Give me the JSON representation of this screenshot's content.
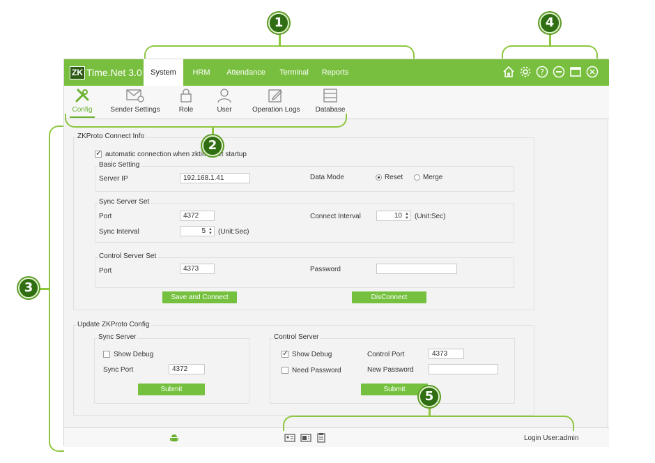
{
  "callouts": [
    "1",
    "2",
    "3",
    "4",
    "5"
  ],
  "app": {
    "logo_mark": "ZK",
    "logo_text": "Time.Net",
    "version": "3.0",
    "brand_color": "#79bf3f",
    "accent_color": "#6ab12f"
  },
  "nav": [
    {
      "label": "System",
      "active": true
    },
    {
      "label": "HRM",
      "active": false
    },
    {
      "label": "Attendance",
      "active": false
    },
    {
      "label": "Terminal",
      "active": false
    },
    {
      "label": "Reports",
      "active": false
    }
  ],
  "window_icons": [
    "home-icon",
    "gear-icon",
    "help-icon",
    "minimize-icon",
    "maximize-icon",
    "close-icon"
  ],
  "toolbar": [
    {
      "label": "Config",
      "icon": "tools-icon",
      "active": true
    },
    {
      "label": "Sender Settings",
      "icon": "mail-settings-icon",
      "active": false
    },
    {
      "label": "Role",
      "icon": "lock-icon",
      "active": false
    },
    {
      "label": "User",
      "icon": "user-icon",
      "active": false
    },
    {
      "label": "Operation Logs",
      "icon": "edit-log-icon",
      "active": false
    },
    {
      "label": "Database",
      "icon": "database-icon",
      "active": false
    }
  ],
  "connect": {
    "title": "ZKProto Connect Info",
    "auto_label": "automatic connection when zktime net startup",
    "auto_checked": true,
    "basic": {
      "title": "Basic Setting",
      "server_ip_label": "Server IP",
      "server_ip": "192.168.1.41",
      "data_mode_label": "Data Mode",
      "mode_reset": "Reset",
      "mode_merge": "Merge",
      "selected_mode": "Reset"
    },
    "sync": {
      "title": "Sync Server Set",
      "port_label": "Port",
      "port": "4372",
      "connect_interval_label": "Connect Interval",
      "connect_interval": "10",
      "connect_unit": "(Unit:Sec)",
      "sync_interval_label": "Sync Interval",
      "sync_interval": "5",
      "sync_unit": "(Unit:Sec)"
    },
    "control": {
      "title": "Control Server Set",
      "port_label": "Port",
      "port": "4373",
      "password_label": "Password",
      "password": ""
    },
    "save_button": "Save and Connect",
    "disconnect_button": "DisConnect"
  },
  "update": {
    "title": "Update ZKProto Config",
    "sync": {
      "title": "Sync Server",
      "show_debug_label": "Show Debug",
      "show_debug": false,
      "port_label": "Sync Port",
      "port": "4372",
      "submit": "Submit"
    },
    "control": {
      "title": "Control Server",
      "show_debug_label": "Show Debug",
      "show_debug": true,
      "need_password_label": "Need Password",
      "need_password": false,
      "control_port_label": "Control Port",
      "control_port": "4373",
      "new_password_label": "New Password",
      "new_password": "",
      "submit": "Submit"
    }
  },
  "status": {
    "icons": [
      "android-icon",
      "id-card-icon",
      "device-icon",
      "clipboard-icon"
    ],
    "login": "Login User:admin"
  }
}
